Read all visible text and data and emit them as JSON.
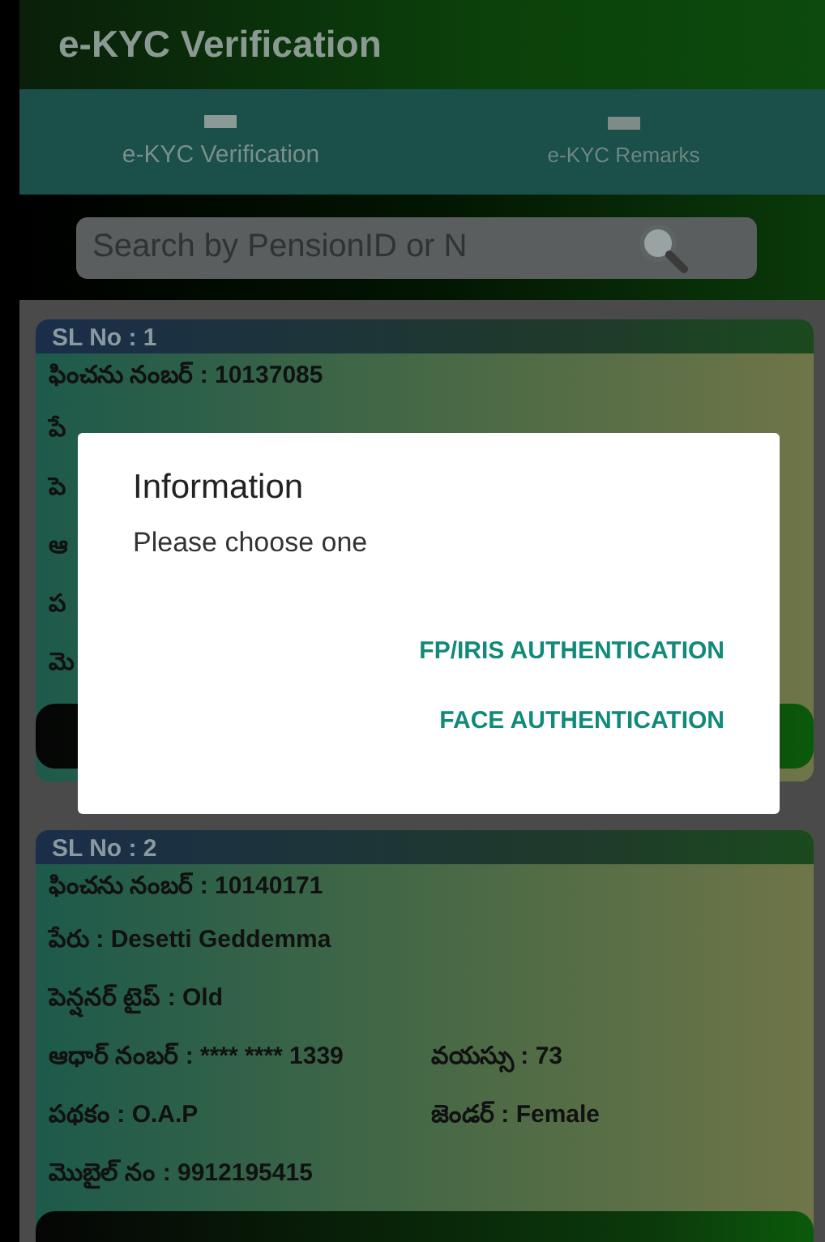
{
  "app_bar": {
    "title": "e-KYC Verification"
  },
  "tabs": [
    {
      "label": "e-KYC Verification",
      "selected": true
    },
    {
      "label": "e-KYC Remarks",
      "selected": false
    }
  ],
  "search": {
    "placeholder": "Search by PensionID or N"
  },
  "cards": [
    {
      "serial": "SL No : 1",
      "rows": [
        [
          "ఫించను నంబర్ : 10137085"
        ],
        [
          "పే"
        ],
        [
          "పె"
        ],
        [
          "ఆ"
        ],
        [
          "ప"
        ],
        [
          "మె"
        ]
      ],
      "has_action_bar": true
    },
    {
      "serial": "SL No : 2",
      "rows": [
        [
          "ఫించను నంబర్ : 10140171"
        ],
        [
          "పేరు : Desetti Geddemma"
        ],
        [
          "పెన్షనర్ టైప్ : Old"
        ],
        [
          "ఆధార్ నంబర్ : **** **** 1339",
          "వయస్సు : 73"
        ],
        [
          "పథకం : O.A.P",
          "జెండర్ : Female"
        ],
        [
          "మొబైల్ నం : 9912195415"
        ]
      ],
      "has_action_bar": true
    }
  ],
  "dialog": {
    "title": "Information",
    "message": "Please choose one",
    "actions": [
      "FP/IRIS AUTHENTICATION",
      "FACE AUTHENTICATION"
    ]
  }
}
